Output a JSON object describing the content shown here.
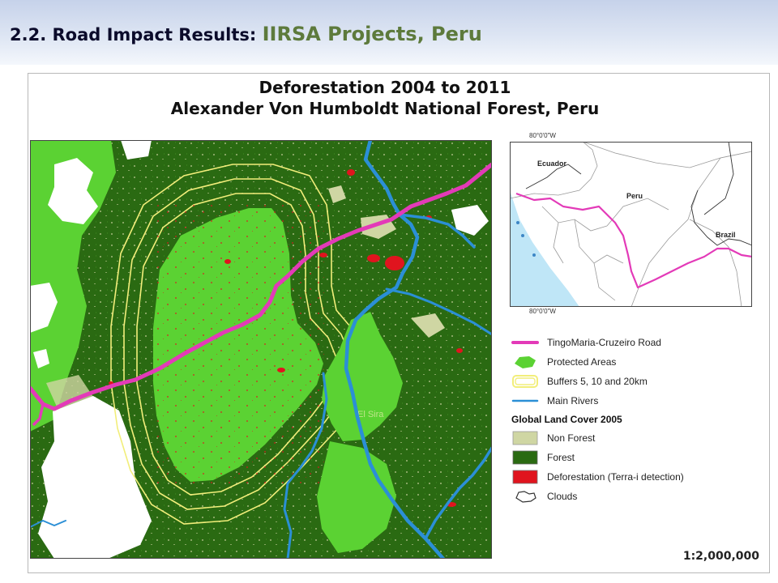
{
  "header": {
    "prefix": "2.2.  Road Impact Results: ",
    "subtitle": "IIRSA Projects, Peru"
  },
  "map": {
    "title_line1": "Deforestation 2004 to 2011",
    "title_line2": "Alexander Von Humboldt National Forest, Peru",
    "place_label": "El Sira",
    "scale": "1:2,000,000"
  },
  "inset": {
    "labels": [
      "Ecuador",
      "Peru",
      "Brazil"
    ],
    "lon_top": "80°0'0\"W",
    "lon_bottom": "80°0'0\"W"
  },
  "legend": {
    "items": [
      {
        "label": "TingoMaria-Cruzeiro Road",
        "icon": "road-line-icon"
      },
      {
        "label": "Protected Areas",
        "icon": "protected-area-icon"
      },
      {
        "label": "Buffers 5, 10 and 20km",
        "icon": "buffer-icon"
      },
      {
        "label": "Main Rivers",
        "icon": "river-line-icon"
      }
    ],
    "heading": "Global Land Cover 2005",
    "cover_items": [
      {
        "label": "Non Forest",
        "color": "#cfd6a3"
      },
      {
        "label": "Forest",
        "color": "#2a6a12"
      },
      {
        "label": "Deforestation (Terra-i detection)",
        "color": "#e0141e"
      },
      {
        "label": "Clouds",
        "icon": "cloud-outline-icon"
      }
    ]
  },
  "colors": {
    "forest": "#2a6a12",
    "protected": "#5bd233",
    "non_forest": "#cfd6a3",
    "deforestation": "#e0141e",
    "road": "#e33ab8",
    "buffer": "#f2ee7a",
    "river": "#2b8fd6",
    "sea": "#bfe6f7"
  }
}
